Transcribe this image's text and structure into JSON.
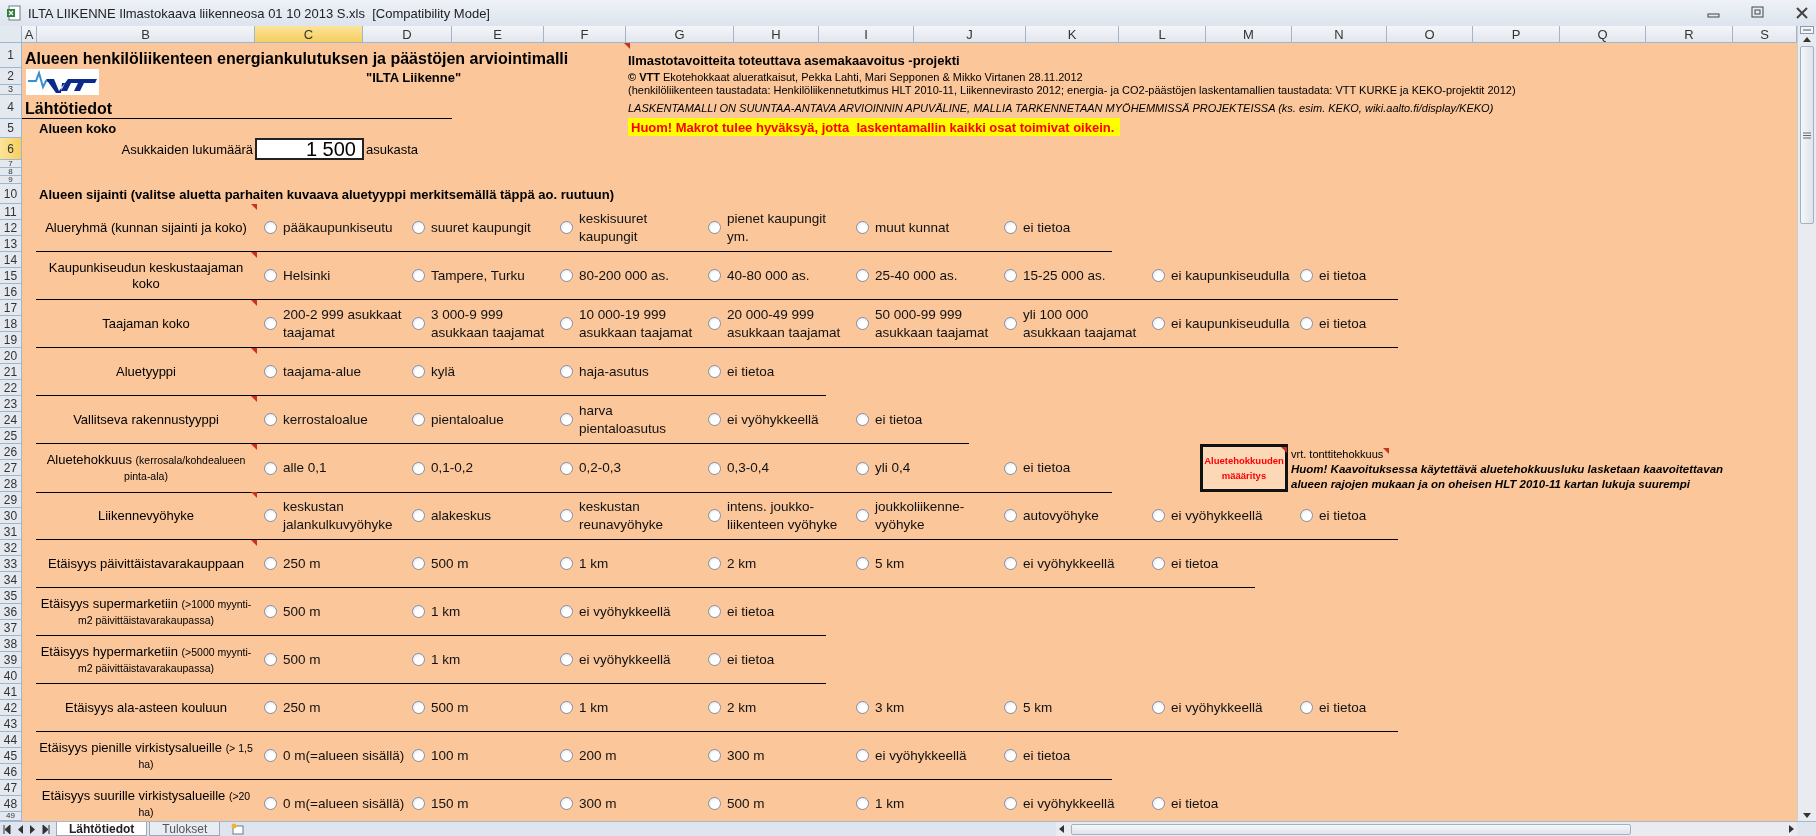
{
  "window": {
    "title": "ILTA LIIKENNE Ilmastokaava liikenneosa 01 10 2013 S.xls  [Compatibility Mode]"
  },
  "columns": [
    {
      "label": "A",
      "selected": false
    },
    {
      "label": "B",
      "selected": false
    },
    {
      "label": "C",
      "selected": true
    },
    {
      "label": "D",
      "selected": false
    },
    {
      "label": "E",
      "selected": false
    },
    {
      "label": "F",
      "selected": false
    },
    {
      "label": "G",
      "selected": false
    },
    {
      "label": "H",
      "selected": false
    },
    {
      "label": "I",
      "selected": false
    },
    {
      "label": "J",
      "selected": false
    },
    {
      "label": "K",
      "selected": false
    },
    {
      "label": "L",
      "selected": false
    },
    {
      "label": "M",
      "selected": false
    },
    {
      "label": "N",
      "selected": false
    },
    {
      "label": "O",
      "selected": false
    },
    {
      "label": "P",
      "selected": false
    },
    {
      "label": "Q",
      "selected": false
    },
    {
      "label": "R",
      "selected": false
    },
    {
      "label": "S",
      "selected": false
    }
  ],
  "rows": [
    {
      "label": "1",
      "selected": false
    },
    {
      "label": "2",
      "selected": false
    },
    {
      "label": "3",
      "selected": false
    },
    {
      "label": "4",
      "selected": false
    },
    {
      "label": "5",
      "selected": false
    },
    {
      "label": "6",
      "selected": true
    },
    {
      "label": "7",
      "selected": false
    },
    {
      "label": "8",
      "selected": false
    },
    {
      "label": "9",
      "selected": false
    },
    {
      "label": "10",
      "selected": false
    },
    {
      "label": "11",
      "selected": false
    },
    {
      "label": "12",
      "selected": false
    },
    {
      "label": "13",
      "selected": false
    },
    {
      "label": "14",
      "selected": false
    },
    {
      "label": "15",
      "selected": false
    },
    {
      "label": "16",
      "selected": false
    },
    {
      "label": "17",
      "selected": false
    },
    {
      "label": "18",
      "selected": false
    },
    {
      "label": "19",
      "selected": false
    },
    {
      "label": "20",
      "selected": false
    },
    {
      "label": "21",
      "selected": false
    },
    {
      "label": "22",
      "selected": false
    },
    {
      "label": "23",
      "selected": false
    },
    {
      "label": "24",
      "selected": false
    },
    {
      "label": "25",
      "selected": false
    },
    {
      "label": "26",
      "selected": false
    },
    {
      "label": "27",
      "selected": false
    },
    {
      "label": "28",
      "selected": false
    },
    {
      "label": "29",
      "selected": false
    },
    {
      "label": "30",
      "selected": false
    },
    {
      "label": "31",
      "selected": false
    },
    {
      "label": "32",
      "selected": false
    },
    {
      "label": "33",
      "selected": false
    },
    {
      "label": "34",
      "selected": false
    },
    {
      "label": "35",
      "selected": false
    },
    {
      "label": "36",
      "selected": false
    },
    {
      "label": "37",
      "selected": false
    },
    {
      "label": "38",
      "selected": false
    },
    {
      "label": "39",
      "selected": false
    },
    {
      "label": "40",
      "selected": false
    },
    {
      "label": "41",
      "selected": false
    },
    {
      "label": "42",
      "selected": false
    },
    {
      "label": "43",
      "selected": false
    },
    {
      "label": "44",
      "selected": false
    },
    {
      "label": "45",
      "selected": false
    },
    {
      "label": "46",
      "selected": false
    },
    {
      "label": "47",
      "selected": false
    },
    {
      "label": "48",
      "selected": false
    },
    {
      "label": "49",
      "selected": false
    }
  ],
  "header": {
    "title": "Alueen henkilöliikenteen energiankulutuksen ja päästöjen arviointimalli",
    "comment": true,
    "subtitle": "\"ILTA Liikenne\"",
    "section": "Lähtötiedot",
    "subsection": "Alueen koko",
    "population": {
      "label": "Asukkaiden lukumäärä",
      "value": "1 500",
      "unit": "asukasta"
    }
  },
  "project": {
    "title": "Ilmastotavoitteita toteuttava asemakaavoitus -projekti",
    "credit": "**© VTT** Ekotehokkaat alueratkaisut, Pekka Lahti, Mari Sepponen & Mikko Virtanen 28.11.2012",
    "data_note": "(henkilöliikenteen taustadata: Henkilöliikennetutkimus HLT 2010-11, Liikennevirasto 2012; energia- ja CO2-päästöjen laskentamallien taustadata: VTT KURKE ja KEKO-projektit 2012)",
    "disclaimer": "LASKENTAMALLI ON SUUNTAA-ANTAVA ARVIOINNIN APUVÄLINE, MALLIA TARKENNETAAN MYÖHEMMISSÄ PROJEKTEISSA (ks. esim. KEKO, wiki.aalto.fi/display/KEKO)",
    "warning": "Huom! Makrot tulee hyväksyä, jotta  laskentamallin kaikki osat toimivat oikein."
  },
  "location_heading": "Alueen sijainti (valitse aluetta parhaiten kuvaava aluetyyppi merkitsemällä täppä ao. ruutuun)",
  "questions": [
    {
      "label": "Alueryhmä (kunnan sijainti ja koko)",
      "comment": true,
      "options": [
        {
          "label": "pääkaupunkiseutu",
          "selected": false
        },
        {
          "label": "suuret kaupungit",
          "selected": false
        },
        {
          "label": "keskisuuret\nkaupungit",
          "selected": false
        },
        {
          "label": "pienet kaupungit\nym.",
          "selected": false
        },
        {
          "label": "muut kunnat",
          "selected": false
        },
        {
          "label": "ei tietoa",
          "selected": false
        }
      ]
    },
    {
      "label": "Kaupunkiseudun keskustaajaman koko",
      "comment": true,
      "options": [
        {
          "label": "Helsinki",
          "selected": false
        },
        {
          "label": "Tampere, Turku",
          "selected": false
        },
        {
          "label": "80-200 000 as.",
          "selected": false
        },
        {
          "label": "40-80 000 as.",
          "selected": false
        },
        {
          "label": "25-40 000 as.",
          "selected": false
        },
        {
          "label": "15-25 000 as.",
          "selected": false
        },
        {
          "label": "ei kaupunkiseudulla",
          "selected": false
        },
        {
          "label": "ei tietoa",
          "selected": false
        }
      ]
    },
    {
      "label": "Taajaman koko",
      "comment": true,
      "options": [
        {
          "label": "200-2 999 asukkaat\ntaajamat",
          "selected": false
        },
        {
          "label": "3 000-9 999\nasukkaan taajamat",
          "selected": false
        },
        {
          "label": "10 000-19 999\nasukkaan taajamat",
          "selected": false
        },
        {
          "label": "20 000-49 999\nasukkaan taajamat",
          "selected": false
        },
        {
          "label": "50 000-99 999\nasukkaan taajamat",
          "selected": false
        },
        {
          "label": "yli 100 000\nasukkaan taajamat",
          "selected": false
        },
        {
          "label": "ei kaupunkiseudulla",
          "selected": false
        },
        {
          "label": "ei tietoa",
          "selected": false
        }
      ]
    },
    {
      "label": "Aluetyyppi",
      "comment": true,
      "options": [
        {
          "label": "taajama-alue",
          "selected": false
        },
        {
          "label": "kylä",
          "selected": false
        },
        {
          "label": "haja-asutus",
          "selected": false
        },
        {
          "label": "ei tietoa",
          "selected": false
        }
      ]
    },
    {
      "label": "Vallitseva rakennustyyppi",
      "comment": true,
      "options": [
        {
          "label": "kerrostaloalue",
          "selected": false
        },
        {
          "label": "pientaloalue",
          "selected": false
        },
        {
          "label": "harva\npientaloasutus",
          "selected": false
        },
        {
          "label": "ei vyöhykkeellä",
          "selected": false
        },
        {
          "label": "ei tietoa",
          "selected": false
        }
      ]
    },
    {
      "label": "Aluetehokkuus",
      "note": "(kerrosala/kohdealueen pinta-ala)",
      "comment": true,
      "options": [
        {
          "label": "alle 0,1",
          "selected": false
        },
        {
          "label": "0,1-0,2",
          "selected": false
        },
        {
          "label": "0,2-0,3",
          "selected": false
        },
        {
          "label": "0,3-0,4",
          "selected": false
        },
        {
          "label": "yli 0,4",
          "selected": false
        },
        {
          "label": "ei tietoa",
          "selected": false
        }
      ],
      "aside": {
        "button": "Aluetehokkuuden määäritys",
        "button_comment": true,
        "reference": "vrt. tonttitehokkuus",
        "reference_comment": true,
        "note": "Huom! Kaavoituksessa käytettävä aluetehokkuusluku lasketaan kaavoitettavan alueen rajojen mukaan ja on oheisen HLT 2010-11 kartan lukuja suurempi"
      }
    },
    {
      "label": "Liikennevyöhyke",
      "comment": true,
      "options": [
        {
          "label": "keskustan\njalankulkuvyöhyke",
          "selected": false
        },
        {
          "label": "alakeskus",
          "selected": false
        },
        {
          "label": "keskustan\nreunavyöhyke",
          "selected": false
        },
        {
          "label": "intens. joukko-\nliikenteen vyöhyke",
          "selected": false
        },
        {
          "label": "joukkoliikenne-\nvyöhyke",
          "selected": false
        },
        {
          "label": "autovyöhyke",
          "selected": false
        },
        {
          "label": "ei vyöhykkeellä",
          "selected": false
        },
        {
          "label": "ei tietoa",
          "selected": false
        }
      ]
    },
    {
      "label": "Etäisyys päivittäistavarakauppaan",
      "comment": true,
      "options": [
        {
          "label": "250 m",
          "selected": false
        },
        {
          "label": "500 m",
          "selected": false
        },
        {
          "label": "1 km",
          "selected": false
        },
        {
          "label": "2 km",
          "selected": false
        },
        {
          "label": "5 km",
          "selected": false
        },
        {
          "label": "ei vyöhykkeellä",
          "selected": false
        },
        {
          "label": "ei tietoa",
          "selected": false
        }
      ]
    },
    {
      "label": "Etäisyys supermarketiin",
      "note": "(>1000 myynti-m2 päivittäistavarakaupassa)",
      "options": [
        {
          "label": "500 m",
          "selected": false
        },
        {
          "label": "1 km",
          "selected": false
        },
        {
          "label": "ei vyöhykkeellä",
          "selected": false
        },
        {
          "label": "ei tietoa",
          "selected": false
        }
      ]
    },
    {
      "label": "Etäisyys hypermarketiin",
      "note": "(>5000 myynti-m2 päivittäistavarakaupassa)",
      "options": [
        {
          "label": "500 m",
          "selected": false
        },
        {
          "label": "1 km",
          "selected": false
        },
        {
          "label": "ei vyöhykkeellä",
          "selected": false
        },
        {
          "label": "ei tietoa",
          "selected": false
        }
      ]
    },
    {
      "label": "Etäisyys ala-asteen kouluun",
      "options": [
        {
          "label": "250 m",
          "selected": false
        },
        {
          "label": "500 m",
          "selected": false
        },
        {
          "label": "1 km",
          "selected": false
        },
        {
          "label": "2 km",
          "selected": false
        },
        {
          "label": "3 km",
          "selected": false
        },
        {
          "label": "5 km",
          "selected": false
        },
        {
          "label": "ei vyöhykkeellä",
          "selected": false
        },
        {
          "label": "ei tietoa",
          "selected": false
        }
      ]
    },
    {
      "label": "Etäisyys pienille virkistysalueille",
      "note": "(> 1,5 ha)",
      "options": [
        {
          "label": "0 m(=alueen sisällä)",
          "selected": false
        },
        {
          "label": "100 m",
          "selected": false
        },
        {
          "label": "200 m",
          "selected": false
        },
        {
          "label": "300 m",
          "selected": false
        },
        {
          "label": "ei vyöhykkeellä",
          "selected": false
        },
        {
          "label": "ei tietoa",
          "selected": false
        }
      ]
    },
    {
      "label": "Etäisyys suurille virkistysalueille",
      "note": "(>20 ha)",
      "options": [
        {
          "label": "0 m(=alueen sisällä)",
          "selected": false
        },
        {
          "label": "150 m",
          "selected": false
        },
        {
          "label": "300 m",
          "selected": false
        },
        {
          "label": "500 m",
          "selected": false
        },
        {
          "label": "1 km",
          "selected": false
        },
        {
          "label": "ei vyöhykkeellä",
          "selected": false
        },
        {
          "label": "ei tietoa",
          "selected": false
        }
      ]
    }
  ],
  "sheet_tabs": [
    {
      "label": "Lähtötiedot",
      "selected": true
    },
    {
      "label": "Tulokset",
      "selected": false
    }
  ]
}
